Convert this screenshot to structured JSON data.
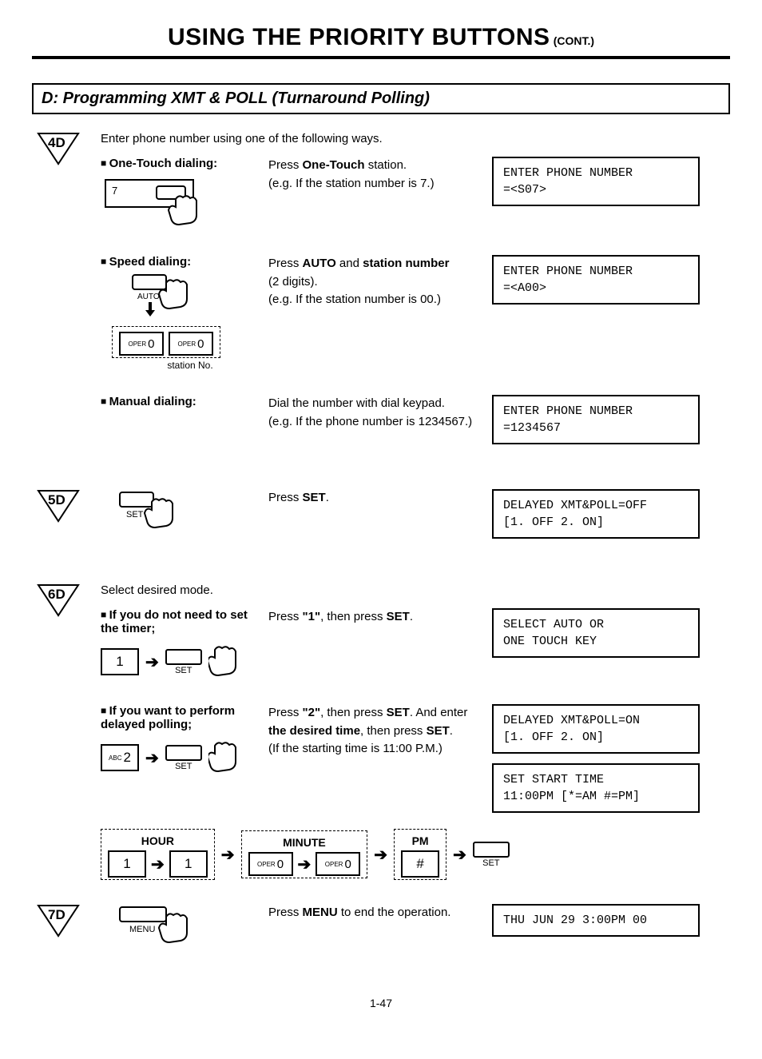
{
  "title": {
    "main": "USING THE PRIORITY BUTTONS",
    "cont": "(CONT.)"
  },
  "section": "D:  Programming XMT & POLL (Turnaround Polling)",
  "steps": {
    "s4": {
      "marker": "4D",
      "intro": "Enter phone number using one of the following ways.",
      "one_touch": {
        "head": "One-Touch dialing:",
        "key7": "7",
        "instr_pre": "Press ",
        "instr_bold": "One-Touch",
        "instr_post": " station.",
        "eg": "(e.g. If the station number is 7.)",
        "lcd": "ENTER PHONE NUMBER\n=<S07>"
      },
      "speed": {
        "head": "Speed dialing:",
        "auto_label": "AUTO",
        "oper": "OPER",
        "zero": "0",
        "station_no": "station No.",
        "instr_p1": "Press ",
        "instr_b1": "AUTO",
        "instr_p2": " and ",
        "instr_b2": "station number",
        "instr_p3": " (2 digits).",
        "eg": "(e.g. If the station number is 00.)",
        "lcd": "ENTER PHONE NUMBER\n=<A00>"
      },
      "manual": {
        "head": "Manual dialing:",
        "instr": "Dial the number with dial keypad.",
        "eg": "(e.g. If the phone number is 1234567.)",
        "lcd": "ENTER PHONE NUMBER\n=1234567"
      }
    },
    "s5": {
      "marker": "5D",
      "set_label": "SET",
      "instr_pre": "Press ",
      "instr_bold": "SET",
      "instr_post": ".",
      "lcd": "DELAYED XMT&POLL=OFF\n[1. OFF 2. ON]"
    },
    "s6": {
      "marker": "6D",
      "intro": "Select desired mode.",
      "no_timer": {
        "head": "If you do not need to set the timer;",
        "key1": "1",
        "set_label": "SET",
        "instr_p1": "Press ",
        "instr_b1": "\"1\"",
        "instr_p2": ", then press ",
        "instr_b2": "SET",
        "instr_p3": ".",
        "lcd": "SELECT AUTO OR\nONE TOUCH KEY"
      },
      "delayed": {
        "head": "If you want to perform delayed polling;",
        "abc": "ABC",
        "key2": "2",
        "set_label": "SET",
        "instr_p1": "Press ",
        "instr_b1": "\"2\"",
        "instr_p2": ", then press ",
        "instr_b2": "SET",
        "instr_p3": ". And enter ",
        "instr_b3": "the desired time",
        "instr_p4": ", then press ",
        "instr_b4": "SET",
        "instr_p5": ".",
        "eg": "(If the starting time is 11:00 P.M.)",
        "lcd1": "DELAYED XMT&POLL=ON\n[1. OFF 2. ON]",
        "lcd2": "SET START TIME\n11:00PM [*=AM #=PM]"
      },
      "time_row": {
        "hour": "HOUR",
        "minute": "MINUTE",
        "pm": "PM",
        "k1": "1",
        "oper": "OPER",
        "zero": "0",
        "hash": "#",
        "set_label": "SET"
      }
    },
    "s7": {
      "marker": "7D",
      "menu_label": "MENU",
      "instr_p1": "Press ",
      "instr_b1": "MENU",
      "instr_p2": " to end the operation.",
      "lcd": "THU JUN 29 3:00PM 00"
    }
  },
  "page_num": "1-47"
}
